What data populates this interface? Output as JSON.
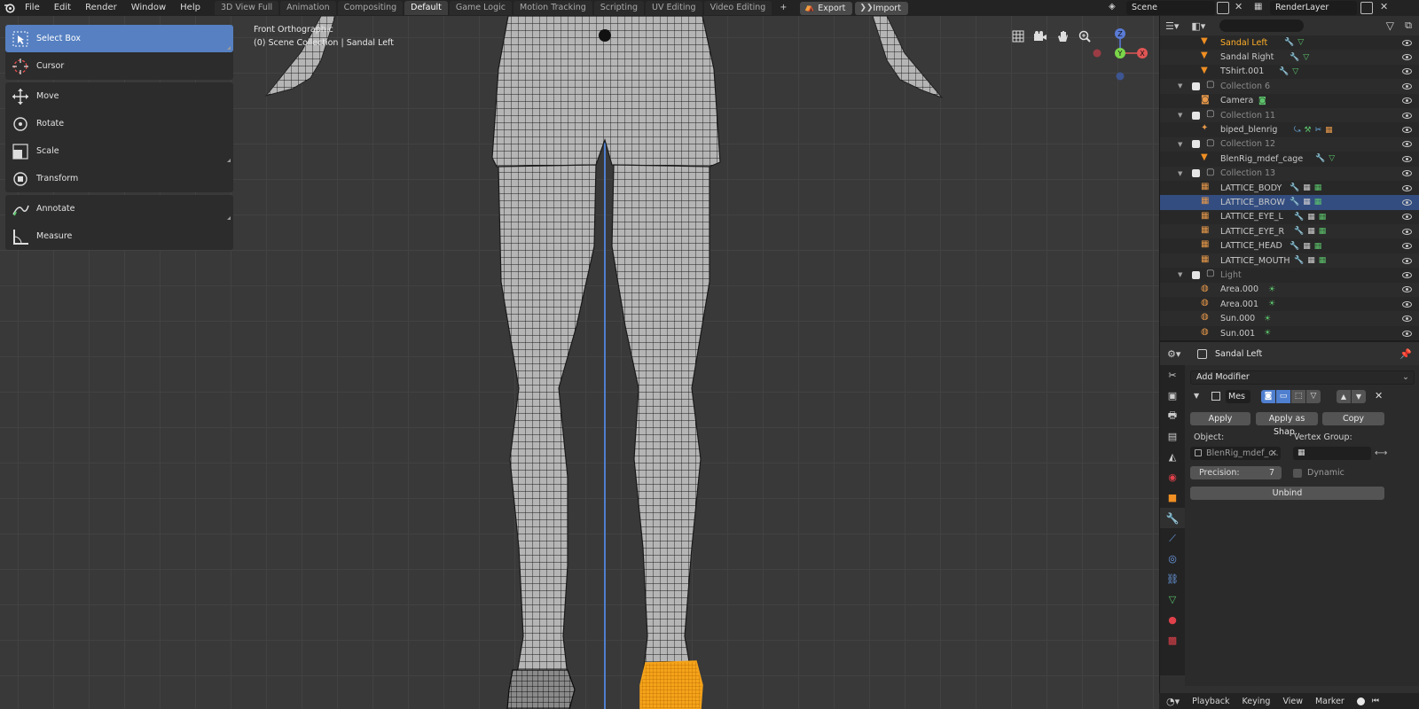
{
  "topbar": {
    "menus": [
      "File",
      "Edit",
      "Render",
      "Window",
      "Help"
    ],
    "workspace_tabs": [
      {
        "label": "3D View Full",
        "active": false
      },
      {
        "label": "Animation",
        "active": false
      },
      {
        "label": "Compositing",
        "active": false
      },
      {
        "label": "Default",
        "active": true
      },
      {
        "label": "Game Logic",
        "active": false
      },
      {
        "label": "Motion Tracking",
        "active": false
      },
      {
        "label": "Scripting",
        "active": false
      },
      {
        "label": "UV Editing",
        "active": false
      },
      {
        "label": "Video Editing",
        "active": false
      }
    ],
    "add_tab": "+",
    "export_label": "Export",
    "import_label": "Import",
    "scene_name": "Scene",
    "view_layer": "RenderLayer"
  },
  "viewport": {
    "view_name": "Front Orthographic",
    "context": "(0) Scene Collection | Sandal Left",
    "gizmo": {
      "x_label": "X",
      "y_label": "Y",
      "z_label": "Z"
    },
    "tools": [
      {
        "label": "Select Box",
        "icon": "select-box-icon",
        "active": true
      },
      {
        "label": "Cursor",
        "icon": "cursor-icon",
        "active": false
      },
      {
        "label": "Move",
        "icon": "move-icon",
        "active": false
      },
      {
        "label": "Rotate",
        "icon": "rotate-icon",
        "active": false
      },
      {
        "label": "Scale",
        "icon": "scale-icon",
        "active": false
      },
      {
        "label": "Transform",
        "icon": "transform-icon",
        "active": false
      },
      {
        "label": "Annotate",
        "icon": "annotate-icon",
        "active": false
      },
      {
        "label": "Measure",
        "icon": "measure-icon",
        "active": false
      }
    ],
    "selection_color": "#f5a31a",
    "axis_color": "#4f7fcf"
  },
  "outliner": {
    "rows": [
      {
        "name": "Sandal Left",
        "type": "mesh",
        "highlight": true
      },
      {
        "name": "Sandal Right",
        "type": "mesh"
      },
      {
        "name": "TShirt.001",
        "type": "mesh"
      },
      {
        "name": "Collection 6",
        "type": "collection"
      },
      {
        "name": "Camera",
        "type": "camera"
      },
      {
        "name": "Collection 11",
        "type": "collection"
      },
      {
        "name": "biped_blenrig",
        "type": "armature"
      },
      {
        "name": "Collection 12",
        "type": "collection"
      },
      {
        "name": "BlenRig_mdef_cage",
        "type": "mesh"
      },
      {
        "name": "Collection 13",
        "type": "collection"
      },
      {
        "name": "LATTICE_BODY",
        "type": "lattice"
      },
      {
        "name": "LATTICE_BROW",
        "type": "lattice",
        "selected": true
      },
      {
        "name": "LATTICE_EYE_L",
        "type": "lattice"
      },
      {
        "name": "LATTICE_EYE_R",
        "type": "lattice"
      },
      {
        "name": "LATTICE_HEAD",
        "type": "lattice"
      },
      {
        "name": "LATTICE_MOUTH",
        "type": "lattice"
      },
      {
        "name": "Light",
        "type": "collection"
      },
      {
        "name": "Area.000",
        "type": "light"
      },
      {
        "name": "Area.001",
        "type": "light"
      },
      {
        "name": "Sun.000",
        "type": "light"
      },
      {
        "name": "Sun.001",
        "type": "light"
      }
    ]
  },
  "properties": {
    "object_name": "Sandal Left",
    "add_modifier": "Add Modifier",
    "modifier_name": "Mes",
    "apply_label": "Apply",
    "apply_shape_label": "Apply as Shap..",
    "copy_label": "Copy",
    "object_label": "Object:",
    "object_value": "BlenRig_mdef_c..",
    "vertex_group_label": "Vertex Group:",
    "precision_label": "Precision:",
    "precision_value": "7",
    "dynamic_label": "Dynamic",
    "unbind_label": "Unbind"
  },
  "timeline": {
    "playback": "Playback",
    "keying": "Keying",
    "view": "View",
    "marker": "Marker"
  }
}
